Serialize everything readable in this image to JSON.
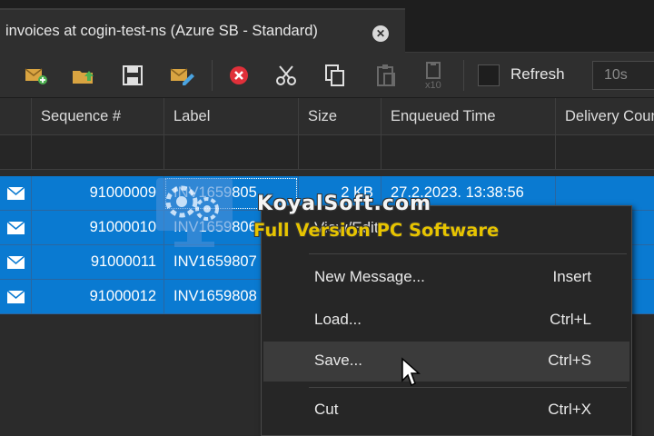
{
  "tab": {
    "title": "invoices at cogin-test-ns (Azure SB - Standard)"
  },
  "toolbar": {
    "icons": [
      "new-message-icon",
      "import-icon",
      "save-icon",
      "edit-icon",
      "delete-icon",
      "cut-icon",
      "copy-icon",
      "paste-icon",
      "paste-x10-icon"
    ],
    "refresh_label": "Refresh",
    "refresh_interval": "10s",
    "x10_label": "x10"
  },
  "grid": {
    "columns": [
      "Sequence #",
      "Label",
      "Size",
      "Enqueued Time",
      "Delivery Count"
    ],
    "rows": [
      {
        "sequence": "91000009",
        "label": "INV1659805",
        "size": "2 KB",
        "enqueued": "27.2.2023. 13:38:56"
      },
      {
        "sequence": "91000010",
        "label": "INV1659806",
        "size": "",
        "enqueued": ""
      },
      {
        "sequence": "91000011",
        "label": "INV1659807",
        "size": "",
        "enqueued": ""
      },
      {
        "sequence": "91000012",
        "label": "INV1659808",
        "size": "",
        "enqueued": ""
      }
    ]
  },
  "watermark": {
    "line1": "KoyalSoft.com",
    "line2": "Full Version PC Software"
  },
  "context_menu": {
    "top_item": "View/Edit",
    "items": [
      {
        "label": "New Message...",
        "shortcut": "Insert"
      },
      {
        "label": "Load...",
        "shortcut": "Ctrl+L"
      },
      {
        "label": "Save...",
        "shortcut": "Ctrl+S"
      },
      {
        "label": "Cut",
        "shortcut": "Ctrl+X"
      }
    ]
  },
  "colors": {
    "selection": "#0a7ad1",
    "accent_red": "#e0303a",
    "watermark_yellow": "#e7c400"
  }
}
